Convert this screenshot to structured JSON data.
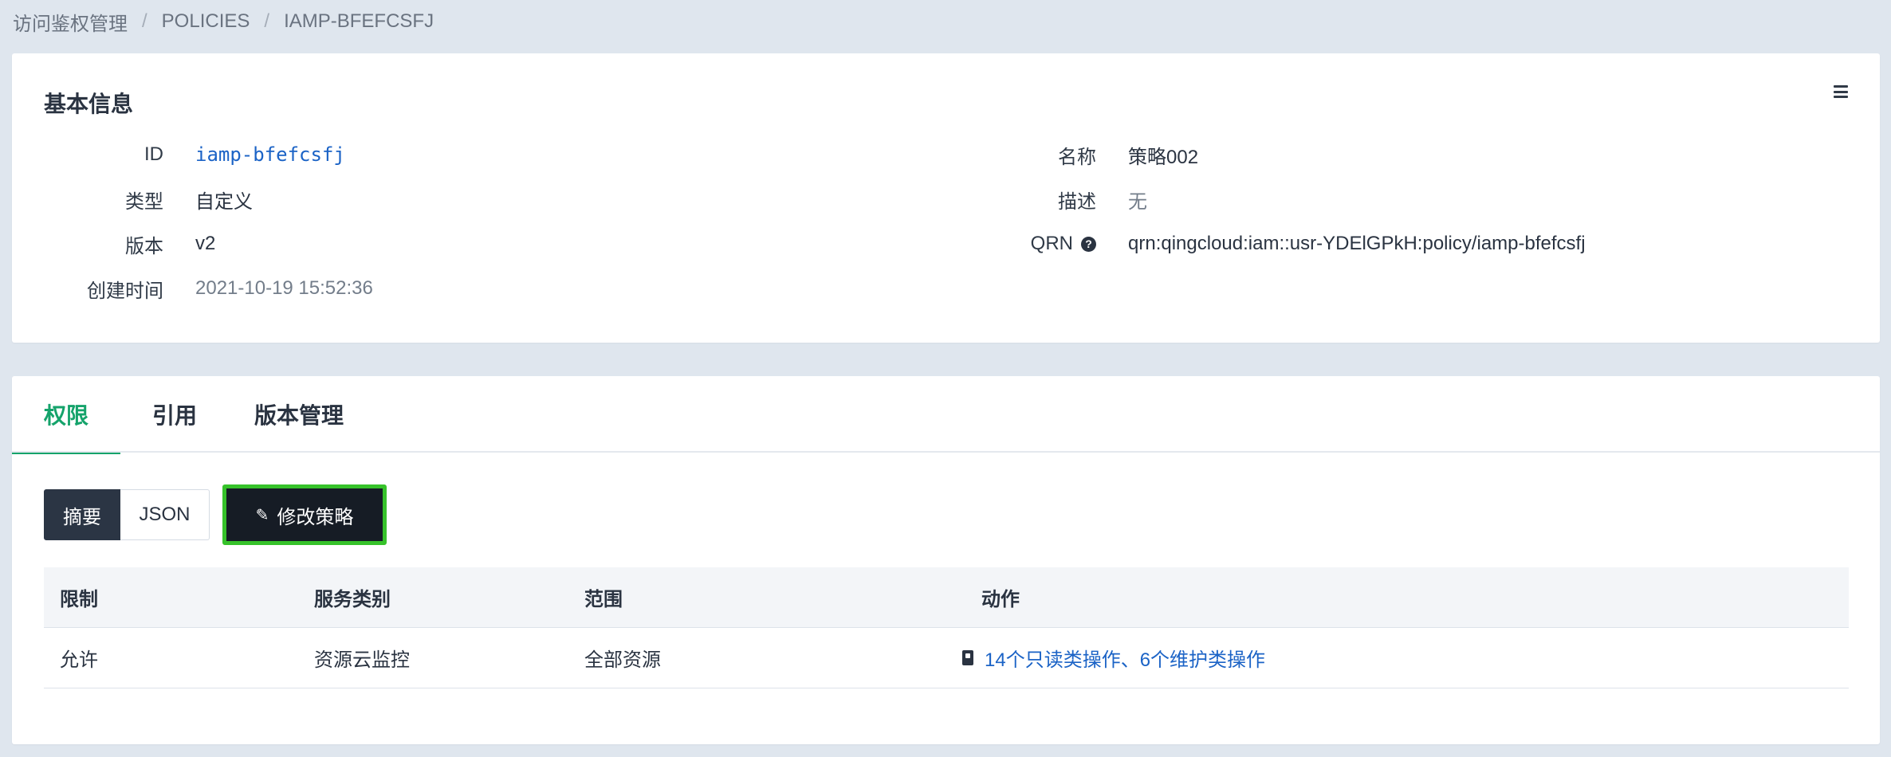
{
  "breadcrumb": {
    "items": [
      "访问鉴权管理",
      "POLICIES",
      "IAMP-BFEFCSFJ"
    ],
    "separator": "/"
  },
  "basic_info": {
    "title": "基本信息",
    "left": [
      {
        "label": "ID",
        "value": "iamp-bfefcsfj"
      },
      {
        "label": "类型",
        "value": "自定义"
      },
      {
        "label": "版本",
        "value": "v2"
      },
      {
        "label": "创建时间",
        "value": "2021-10-19 15:52:36"
      }
    ],
    "right": [
      {
        "label": "名称",
        "value": "策略002"
      },
      {
        "label": "描述",
        "value": "无"
      },
      {
        "label": "QRN",
        "value": "qrn:qingcloud:iam::usr-YDElGPkH:policy/iamp-bfefcsfj"
      }
    ]
  },
  "tabs": [
    {
      "label": "权限",
      "active": true
    },
    {
      "label": "引用",
      "active": false
    },
    {
      "label": "版本管理",
      "active": false
    }
  ],
  "toolbar": {
    "summary_label": "摘要",
    "json_label": "JSON",
    "edit_label": "修改策略"
  },
  "table": {
    "headers": [
      "限制",
      "服务类别",
      "范围",
      "动作"
    ],
    "rows": [
      {
        "limit": "允许",
        "service": "资源云监控",
        "scope": "全部资源",
        "action": "14个只读类操作、6个维护类操作"
      }
    ]
  },
  "colors": {
    "accent_green": "#15a36b",
    "link_blue": "#1b63c6",
    "highlight_border": "#36c22a",
    "page_bg": "#dfe6ee"
  }
}
